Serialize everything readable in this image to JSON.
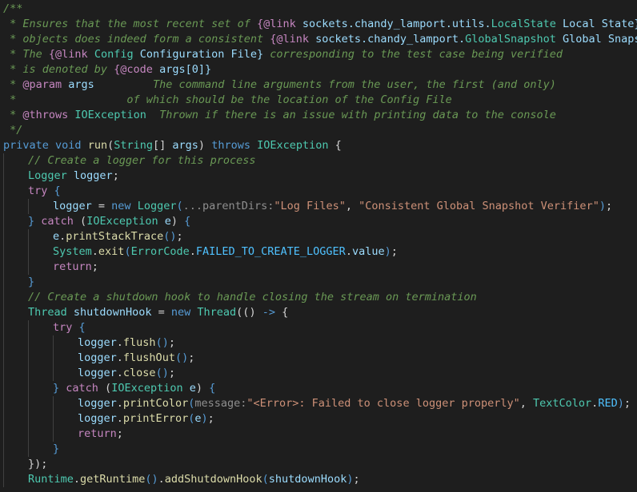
{
  "lines": [
    {
      "indent": 0,
      "tokens": [
        {
          "t": "/**",
          "c": "doc"
        }
      ]
    },
    {
      "indent": 0,
      "tokens": [
        {
          "t": " * Ensures that the most recent set of ",
          "c": "doc"
        },
        {
          "t": "{@link",
          "c": "tag"
        },
        {
          "t": " sockets.chandy_lamport.utils.",
          "c": "var"
        },
        {
          "t": "LocalState",
          "c": "cls"
        },
        {
          "t": " Local State}",
          "c": "var"
        }
      ]
    },
    {
      "indent": 0,
      "tokens": [
        {
          "t": " * objects does indeed form a consistent ",
          "c": "doc"
        },
        {
          "t": "{@link",
          "c": "tag"
        },
        {
          "t": " sockets.chandy_lamport.",
          "c": "var"
        },
        {
          "t": "GlobalSnapshot",
          "c": "cls"
        },
        {
          "t": " Global Snapshot}",
          "c": "var"
        }
      ]
    },
    {
      "indent": 0,
      "tokens": [
        {
          "t": " * The ",
          "c": "doc"
        },
        {
          "t": "{@link",
          "c": "tag"
        },
        {
          "t": " Config",
          "c": "cls"
        },
        {
          "t": " Configuration File}",
          "c": "var"
        },
        {
          "t": " corresponding to the test case being verified",
          "c": "doc"
        }
      ]
    },
    {
      "indent": 0,
      "tokens": [
        {
          "t": " * is denoted by ",
          "c": "doc"
        },
        {
          "t": "{@code",
          "c": "tag"
        },
        {
          "t": " args[0]}",
          "c": "var"
        }
      ]
    },
    {
      "indent": 0,
      "tokens": [
        {
          "t": " * ",
          "c": "doc"
        },
        {
          "t": "@param",
          "c": "tag"
        },
        {
          "t": " args",
          "c": "var"
        },
        {
          "t": "         The command line arguments from the user, the first (and only)",
          "c": "doc"
        }
      ]
    },
    {
      "indent": 0,
      "tokens": [
        {
          "t": " *                 of which should be the location of the Config File",
          "c": "doc"
        }
      ]
    },
    {
      "indent": 0,
      "tokens": [
        {
          "t": " * ",
          "c": "doc"
        },
        {
          "t": "@throws",
          "c": "tag"
        },
        {
          "t": " IOException",
          "c": "cls"
        },
        {
          "t": "  Thrown if there is an issue with printing data to the console",
          "c": "doc"
        }
      ]
    },
    {
      "indent": 0,
      "tokens": [
        {
          "t": " */",
          "c": "doc"
        }
      ]
    },
    {
      "indent": 0,
      "tokens": [
        {
          "t": "private",
          "c": "kw"
        },
        {
          "t": " ",
          "c": "plain"
        },
        {
          "t": "void",
          "c": "kw"
        },
        {
          "t": " ",
          "c": "plain"
        },
        {
          "t": "run",
          "c": "fn"
        },
        {
          "t": "(",
          "c": "plain"
        },
        {
          "t": "String",
          "c": "cls"
        },
        {
          "t": "[] ",
          "c": "plain"
        },
        {
          "t": "args",
          "c": "prm"
        },
        {
          "t": ") ",
          "c": "plain"
        },
        {
          "t": "throws",
          "c": "kw"
        },
        {
          "t": " ",
          "c": "plain"
        },
        {
          "t": "IOException",
          "c": "cls"
        },
        {
          "t": " {",
          "c": "plain"
        }
      ]
    },
    {
      "indent": 1,
      "tokens": [
        {
          "t": "// Create a logger for this process",
          "c": "doc"
        }
      ]
    },
    {
      "indent": 1,
      "tokens": [
        {
          "t": "Logger",
          "c": "cls"
        },
        {
          "t": " ",
          "c": "plain"
        },
        {
          "t": "logger",
          "c": "var"
        },
        {
          "t": ";",
          "c": "plain"
        }
      ]
    },
    {
      "indent": 1,
      "tokens": [
        {
          "t": "try",
          "c": "ctl"
        },
        {
          "t": " {",
          "c": "kw"
        }
      ]
    },
    {
      "indent": 2,
      "tokens": [
        {
          "t": "logger",
          "c": "var"
        },
        {
          "t": " = ",
          "c": "plain"
        },
        {
          "t": "new",
          "c": "kw"
        },
        {
          "t": " ",
          "c": "plain"
        },
        {
          "t": "Logger",
          "c": "cls"
        },
        {
          "t": "(",
          "c": "kw"
        },
        {
          "t": "...parentDirs:",
          "c": "hint"
        },
        {
          "t": "\"Log Files\"",
          "c": "str"
        },
        {
          "t": ", ",
          "c": "plain"
        },
        {
          "t": "\"Consistent Global Snapshot Verifier\"",
          "c": "str"
        },
        {
          "t": ")",
          "c": "kw"
        },
        {
          "t": ";",
          "c": "plain"
        }
      ]
    },
    {
      "indent": 1,
      "tokens": [
        {
          "t": "}",
          "c": "kw"
        },
        {
          "t": " ",
          "c": "plain"
        },
        {
          "t": "catch",
          "c": "ctl"
        },
        {
          "t": " (",
          "c": "plain"
        },
        {
          "t": "IOException",
          "c": "cls"
        },
        {
          "t": " ",
          "c": "plain"
        },
        {
          "t": "e",
          "c": "var"
        },
        {
          "t": ") ",
          "c": "plain"
        },
        {
          "t": "{",
          "c": "kw"
        }
      ]
    },
    {
      "indent": 2,
      "tokens": [
        {
          "t": "e",
          "c": "var"
        },
        {
          "t": ".",
          "c": "plain"
        },
        {
          "t": "printStackTrace",
          "c": "fn"
        },
        {
          "t": "()",
          "c": "kw"
        },
        {
          "t": ";",
          "c": "plain"
        }
      ]
    },
    {
      "indent": 2,
      "tokens": [
        {
          "t": "System",
          "c": "cls"
        },
        {
          "t": ".",
          "c": "plain"
        },
        {
          "t": "exit",
          "c": "fn"
        },
        {
          "t": "(",
          "c": "kw"
        },
        {
          "t": "ErrorCode",
          "c": "cls"
        },
        {
          "t": ".",
          "c": "plain"
        },
        {
          "t": "FAILED_TO_CREATE_LOGGER",
          "c": "const"
        },
        {
          "t": ".",
          "c": "plain"
        },
        {
          "t": "value",
          "c": "var"
        },
        {
          "t": ")",
          "c": "kw"
        },
        {
          "t": ";",
          "c": "plain"
        }
      ]
    },
    {
      "indent": 2,
      "tokens": [
        {
          "t": "return",
          "c": "ctl"
        },
        {
          "t": ";",
          "c": "plain"
        }
      ]
    },
    {
      "indent": 1,
      "tokens": [
        {
          "t": "}",
          "c": "kw"
        }
      ]
    },
    {
      "indent": 1,
      "tokens": [
        {
          "t": "// Create a shutdown hook to handle closing the stream on termination",
          "c": "doc"
        }
      ]
    },
    {
      "indent": 1,
      "tokens": [
        {
          "t": "Thread",
          "c": "cls"
        },
        {
          "t": " ",
          "c": "plain"
        },
        {
          "t": "shutdownHook",
          "c": "var"
        },
        {
          "t": " = ",
          "c": "plain"
        },
        {
          "t": "new",
          "c": "kw"
        },
        {
          "t": " ",
          "c": "plain"
        },
        {
          "t": "Thread",
          "c": "cls"
        },
        {
          "t": "((",
          "c": "plain"
        },
        {
          "t": ") ",
          "c": "plain"
        },
        {
          "t": "->",
          "c": "kw"
        },
        {
          "t": " {",
          "c": "plain"
        }
      ]
    },
    {
      "indent": 2,
      "tokens": [
        {
          "t": "try",
          "c": "ctl"
        },
        {
          "t": " {",
          "c": "kw"
        }
      ]
    },
    {
      "indent": 3,
      "tokens": [
        {
          "t": "logger",
          "c": "var"
        },
        {
          "t": ".",
          "c": "plain"
        },
        {
          "t": "flush",
          "c": "fn"
        },
        {
          "t": "()",
          "c": "kw"
        },
        {
          "t": ";",
          "c": "plain"
        }
      ]
    },
    {
      "indent": 3,
      "tokens": [
        {
          "t": "logger",
          "c": "var"
        },
        {
          "t": ".",
          "c": "plain"
        },
        {
          "t": "flushOut",
          "c": "fn"
        },
        {
          "t": "()",
          "c": "kw"
        },
        {
          "t": ";",
          "c": "plain"
        }
      ]
    },
    {
      "indent": 3,
      "tokens": [
        {
          "t": "logger",
          "c": "var"
        },
        {
          "t": ".",
          "c": "plain"
        },
        {
          "t": "close",
          "c": "fn"
        },
        {
          "t": "()",
          "c": "kw"
        },
        {
          "t": ";",
          "c": "plain"
        }
      ]
    },
    {
      "indent": 2,
      "tokens": [
        {
          "t": "}",
          "c": "kw"
        },
        {
          "t": " ",
          "c": "plain"
        },
        {
          "t": "catch",
          "c": "ctl"
        },
        {
          "t": " (",
          "c": "plain"
        },
        {
          "t": "IOException",
          "c": "cls"
        },
        {
          "t": " ",
          "c": "plain"
        },
        {
          "t": "e",
          "c": "var"
        },
        {
          "t": ") ",
          "c": "plain"
        },
        {
          "t": "{",
          "c": "kw"
        }
      ]
    },
    {
      "indent": 3,
      "tokens": [
        {
          "t": "logger",
          "c": "var"
        },
        {
          "t": ".",
          "c": "plain"
        },
        {
          "t": "printColor",
          "c": "fn"
        },
        {
          "t": "(",
          "c": "kw"
        },
        {
          "t": "message:",
          "c": "hint"
        },
        {
          "t": "\"<Error>: Failed to close logger properly\"",
          "c": "str"
        },
        {
          "t": ", ",
          "c": "plain"
        },
        {
          "t": "TextColor",
          "c": "cls"
        },
        {
          "t": ".",
          "c": "plain"
        },
        {
          "t": "RED",
          "c": "const"
        },
        {
          "t": ")",
          "c": "kw"
        },
        {
          "t": ";",
          "c": "plain"
        }
      ]
    },
    {
      "indent": 3,
      "tokens": [
        {
          "t": "logger",
          "c": "var"
        },
        {
          "t": ".",
          "c": "plain"
        },
        {
          "t": "printError",
          "c": "fn"
        },
        {
          "t": "(",
          "c": "kw"
        },
        {
          "t": "e",
          "c": "var"
        },
        {
          "t": ")",
          "c": "kw"
        },
        {
          "t": ";",
          "c": "plain"
        }
      ]
    },
    {
      "indent": 3,
      "tokens": [
        {
          "t": "return",
          "c": "ctl"
        },
        {
          "t": ";",
          "c": "plain"
        }
      ]
    },
    {
      "indent": 2,
      "tokens": [
        {
          "t": "}",
          "c": "kw"
        }
      ]
    },
    {
      "indent": 1,
      "tokens": [
        {
          "t": "})",
          "c": "plain"
        },
        {
          "t": ";",
          "c": "plain"
        }
      ]
    },
    {
      "indent": 1,
      "tokens": [
        {
          "t": "Runtime",
          "c": "cls"
        },
        {
          "t": ".",
          "c": "plain"
        },
        {
          "t": "getRuntime",
          "c": "fn"
        },
        {
          "t": "()",
          "c": "kw"
        },
        {
          "t": ".",
          "c": "plain"
        },
        {
          "t": "addShutdownHook",
          "c": "fn"
        },
        {
          "t": "(",
          "c": "kw"
        },
        {
          "t": "shutdownHook",
          "c": "var"
        },
        {
          "t": ")",
          "c": "kw"
        },
        {
          "t": ";",
          "c": "plain"
        }
      ]
    }
  ]
}
